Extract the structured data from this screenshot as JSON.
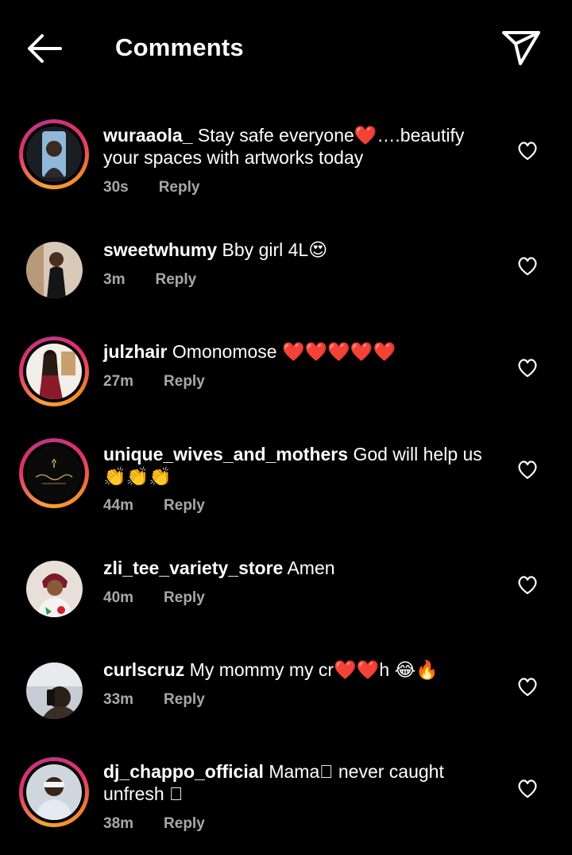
{
  "header": {
    "title": "Comments",
    "back_icon": "arrow-left-icon",
    "share_icon": "paper-plane-icon"
  },
  "colors": {
    "background": "#000000",
    "text": "#ffffff",
    "meta": "#a8a8a8",
    "story_ring_start": "#f7a23a",
    "story_ring_end": "#c13584"
  },
  "comments": [
    {
      "username": "wuraaola_",
      "text_line1": "Stay safe everyone❤️….beautify",
      "text_line2": "your spaces with artworks today",
      "time": "30s",
      "reply": "Reply",
      "story_ring": true
    },
    {
      "username": "sweetwhumy",
      "text_line1": "Bby girl 4L😍",
      "text_line2": "",
      "time": "3m",
      "reply": "Reply",
      "story_ring": false
    },
    {
      "username": "julzhair",
      "text_line1": "Omonomose ❤️❤️❤️❤️❤️",
      "text_line2": "",
      "time": "27m",
      "reply": "Reply",
      "story_ring": true
    },
    {
      "username": "unique_wives_and_mothers",
      "text_line1": "God will help us",
      "text_line2": "👏👏👏",
      "time": "44m",
      "reply": "Reply",
      "story_ring": true
    },
    {
      "username": "zli_tee_variety_store",
      "text_line1": "Amen",
      "text_line2": "",
      "time": "40m",
      "reply": "Reply",
      "story_ring": false
    },
    {
      "username": "curlscruz",
      "text_line1": "My mommy my cr❤️❤️h 😂🔥",
      "text_line2": "",
      "time": "33m",
      "reply": "Reply",
      "story_ring": false
    },
    {
      "username": "dj_chappo_official",
      "text_line1": "Mama󾓦 never caught",
      "text_line2": "unfresh 󾓦",
      "time": "38m",
      "reply": "Reply",
      "story_ring": true
    }
  ]
}
